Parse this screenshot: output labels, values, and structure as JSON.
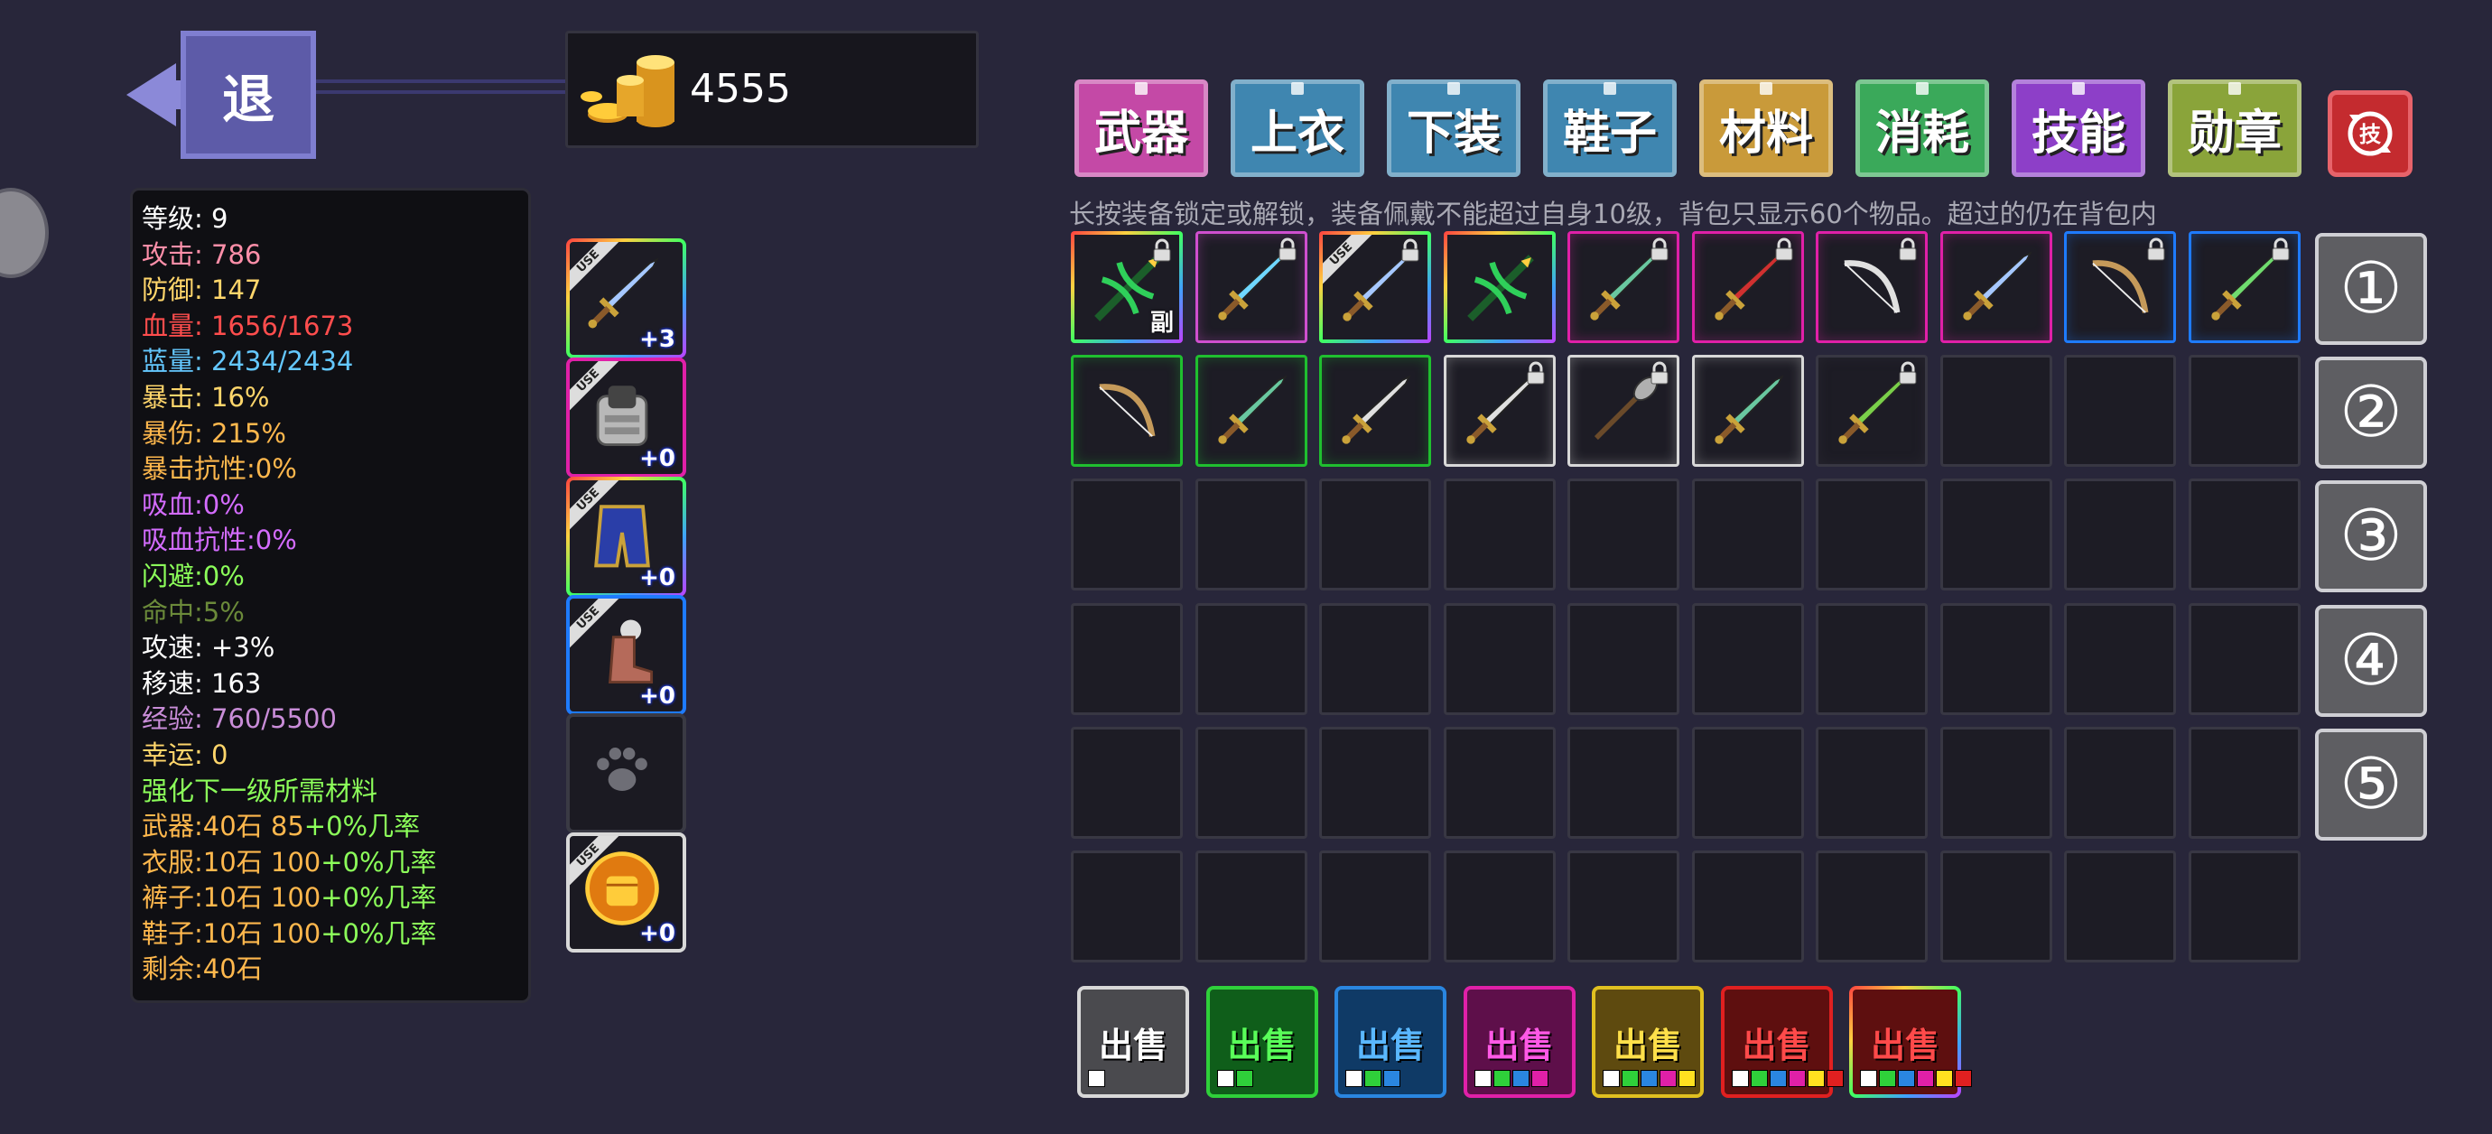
{
  "header": {
    "back_label": "退",
    "gold": "4555"
  },
  "stats": [
    {
      "text": "等级:  9",
      "color": "#ffffff"
    },
    {
      "text": "攻击:  786",
      "color": "#ff8fa9"
    },
    {
      "text": "防御:  147",
      "color": "#ffd66b"
    },
    {
      "text": "血量:  1656/1673",
      "color": "#ff4d4d"
    },
    {
      "text": "蓝量:  2434/2434",
      "color": "#64c8ff"
    },
    {
      "text": "暴击:  16%",
      "color": "#ffd66b"
    },
    {
      "text": "暴伤:  215%",
      "color": "#ffb84d"
    },
    {
      "text": "暴击抗性:0%",
      "color": "#ffb84d"
    },
    {
      "text": "吸血:0%",
      "color": "#d46cff"
    },
    {
      "text": "吸血抗性:0%",
      "color": "#d46cff"
    },
    {
      "text": "闪避:0%",
      "color": "#8cff5a"
    },
    {
      "text": "命中:5%",
      "color": "#6b8a3a"
    },
    {
      "text": "攻速:  +3%",
      "color": "#ffffff"
    },
    {
      "text": "移速:  163",
      "color": "#ffffff"
    },
    {
      "text": "经验:  760/5500",
      "color": "#c98dd8"
    },
    {
      "text": "幸运:  0",
      "color": "#ffd66b"
    },
    {
      "text": "强化下一级所需材料",
      "color": "#8cff5a"
    }
  ],
  "materials": [
    {
      "label": "武器:40石 85",
      "rate": "+0%几率"
    },
    {
      "label": "衣服:10石 100",
      "rate": "+0%几率"
    },
    {
      "label": "裤子:10石 100",
      "rate": "+0%几率"
    },
    {
      "label": "鞋子:10石 100",
      "rate": "+0%几率"
    }
  ],
  "remaining": "剩余:40石",
  "equipment": [
    {
      "name": "weapon",
      "plus": "+3",
      "use": "USE",
      "border": "rainbow",
      "icon": "sword-icon"
    },
    {
      "name": "armor",
      "plus": "+0",
      "use": "USE",
      "border": "#e020a8",
      "icon": "armor-icon"
    },
    {
      "name": "pants",
      "plus": "+0",
      "use": "USE",
      "border": "rainbow",
      "icon": "pants-icon"
    },
    {
      "name": "boots",
      "plus": "+0",
      "use": "USE",
      "border": "#1e7bff",
      "icon": "boots-icon"
    },
    {
      "name": "pet",
      "plus": "",
      "use": "",
      "border": "#3a3a44",
      "icon": "paw-icon"
    },
    {
      "name": "skill",
      "plus": "+0",
      "use": "USE",
      "border": "#d8d8d8",
      "icon": "fist-icon"
    }
  ],
  "tabs": [
    {
      "label": "武器",
      "color": "#c449a6"
    },
    {
      "label": "上衣",
      "color": "#3f86b0"
    },
    {
      "label": "下装",
      "color": "#3f86b0"
    },
    {
      "label": "鞋子",
      "color": "#3f86b0"
    },
    {
      "label": "材料",
      "color": "#c99a3a"
    },
    {
      "label": "消耗",
      "color": "#3aa95a"
    },
    {
      "label": "技能",
      "color": "#8d3fc8"
    },
    {
      "label": "勋章",
      "color": "#8aa43a"
    }
  ],
  "notice": "长按装备锁定或解锁，装备佩戴不能超过自身10级，背包只显示60个物品。超过的仍在背包内",
  "inventory": [
    {
      "border": "rainbow",
      "icon": "crossbow-icon",
      "color": "#2fd05a",
      "lock": true,
      "tag": "副",
      "use": ""
    },
    {
      "border": "#cf4fcf",
      "icon": "sword-icon",
      "color": "#6fd7ff",
      "lock": true,
      "tag": "",
      "use": ""
    },
    {
      "border": "rainbow",
      "icon": "sword-icon",
      "color": "#a6c8ff",
      "lock": true,
      "tag": "",
      "use": "USE"
    },
    {
      "border": "rainbow",
      "icon": "crossbow-icon",
      "color": "#2fd05a",
      "lock": false,
      "tag": "",
      "use": ""
    },
    {
      "border": "#e020a8",
      "icon": "sword-icon",
      "color": "#69c8a0",
      "lock": true,
      "tag": "",
      "use": ""
    },
    {
      "border": "#e020a8",
      "icon": "sword-icon",
      "color": "#d03030",
      "lock": true,
      "tag": "",
      "use": ""
    },
    {
      "border": "#e020a8",
      "icon": "bow-icon",
      "color": "#e0e0e0",
      "lock": true,
      "tag": "",
      "use": ""
    },
    {
      "border": "#e020a8",
      "icon": "sword-icon",
      "color": "#a6c8ff",
      "lock": false,
      "tag": "",
      "use": ""
    },
    {
      "border": "#1e7bff",
      "icon": "bow-icon",
      "color": "#c59a5a",
      "lock": true,
      "tag": "",
      "use": ""
    },
    {
      "border": "#1e7bff",
      "icon": "sword-icon",
      "color": "#6fdc6f",
      "lock": true,
      "tag": "",
      "use": ""
    },
    {
      "border": "#1fbf2f",
      "icon": "bow-icon",
      "color": "#c59a5a",
      "lock": false,
      "tag": "",
      "use": ""
    },
    {
      "border": "#1fbf2f",
      "icon": "sword-icon",
      "color": "#69c8a0",
      "lock": false,
      "tag": "",
      "use": ""
    },
    {
      "border": "#1fbf2f",
      "icon": "sword-icon",
      "color": "#e0e0e0",
      "lock": false,
      "tag": "",
      "use": ""
    },
    {
      "border": "#d8d8d8",
      "icon": "sword-icon",
      "color": "#e0e0e0",
      "lock": true,
      "tag": "",
      "use": ""
    },
    {
      "border": "#d8d8d8",
      "icon": "spear-icon",
      "color": "#b0b0b0",
      "lock": true,
      "tag": "",
      "use": ""
    },
    {
      "border": "#d8d8d8",
      "icon": "sword-icon",
      "color": "#69c8a0",
      "lock": false,
      "tag": "",
      "use": ""
    },
    {
      "border": "#383743",
      "icon": "sword-icon",
      "color": "#7ad04a",
      "lock": true,
      "tag": "",
      "use": ""
    }
  ],
  "pages": [
    "①",
    "②",
    "③",
    "④",
    "⑤"
  ],
  "sell_buttons": [
    {
      "label": "出售",
      "text": "#ffffff",
      "bg": "#4a4a4e",
      "border": "#d8d8d8",
      "squares": [
        "#ffffff"
      ]
    },
    {
      "label": "出售",
      "text": "#59ff59",
      "bg": "#0f5e1a",
      "border": "#2fd03a",
      "squares": [
        "#ffffff",
        "#2fd03a"
      ]
    },
    {
      "label": "出售",
      "text": "#5ab8ff",
      "bg": "#0f3a66",
      "border": "#2a86e0",
      "squares": [
        "#ffffff",
        "#2fd03a",
        "#2a86e0"
      ]
    },
    {
      "label": "出售",
      "text": "#ff59e6",
      "bg": "#5e0f4a",
      "border": "#e020a8",
      "squares": [
        "#ffffff",
        "#2fd03a",
        "#2a86e0",
        "#e020a8"
      ]
    },
    {
      "label": "出售",
      "text": "#ffe04a",
      "bg": "#5e4a0f",
      "border": "#e0c020",
      "squares": [
        "#ffffff",
        "#2fd03a",
        "#2a86e0",
        "#e020a8",
        "#ffe020"
      ]
    },
    {
      "label": "出售",
      "text": "#ff4a4a",
      "bg": "#5e0f0f",
      "border": "#e02020",
      "squares": [
        "#ffffff",
        "#2fd03a",
        "#2a86e0",
        "#e020a8",
        "#ffe020",
        "#e02020"
      ]
    },
    {
      "label": "出售",
      "text": "#ff4a4a",
      "bg": "#5e0f0f",
      "border": "rainbow",
      "squares": [
        "#ffffff",
        "#2fd03a",
        "#2a86e0",
        "#e020a8",
        "#ffe020",
        "#e02020"
      ]
    }
  ]
}
